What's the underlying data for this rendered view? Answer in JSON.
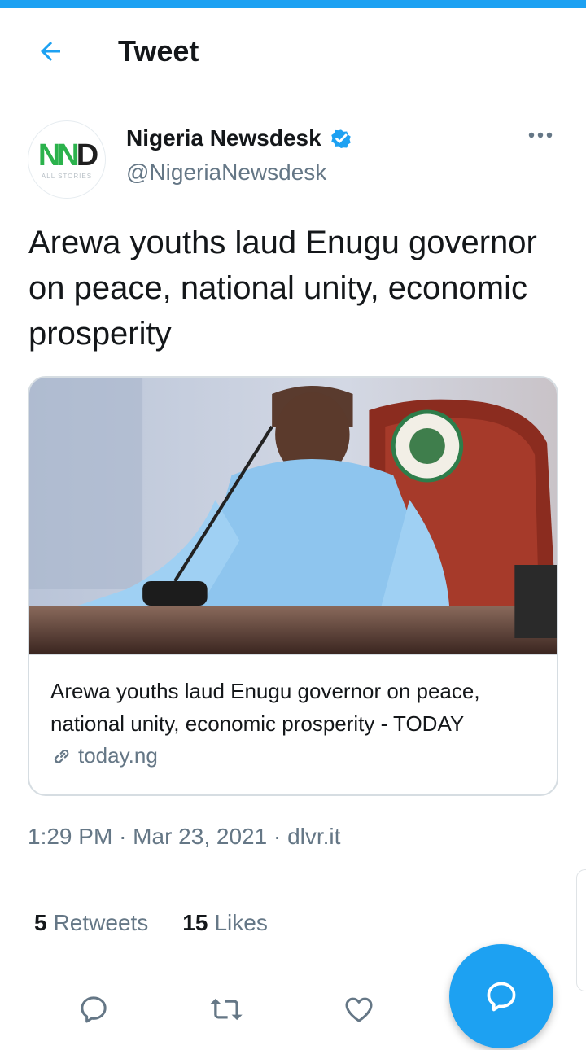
{
  "header": {
    "title": "Tweet",
    "back_icon": "arrow-left-icon"
  },
  "author": {
    "name": "Nigeria Newsdesk",
    "handle": "@NigeriaNewsdesk",
    "verified": true,
    "avatar_logo_text": "NND",
    "avatar_sub_text": "ALL STORIES"
  },
  "tweet": {
    "text": "Arewa youths laud Enugu governor on peace, national unity, economic prosperity"
  },
  "card": {
    "title": "Arewa youths laud Enugu governor on peace, national unity, economic prosperity - TODAY",
    "domain": "today.ng",
    "image_description": "photo"
  },
  "meta": {
    "time": "1:29 PM",
    "separator": "·",
    "date": "Mar 23, 2021",
    "source": "dlvr.it"
  },
  "stats": {
    "retweets_count": "5",
    "retweets_label": "Retweets",
    "likes_count": "15",
    "likes_label": "Likes"
  },
  "actions": {
    "reply_icon": "reply-icon",
    "retweet_icon": "retweet-icon",
    "like_icon": "heart-icon",
    "compose_icon": "compose-reply-icon"
  },
  "colors": {
    "accent": "#1da1f2",
    "text": "#14171a",
    "secondary": "#657786",
    "border": "#dfe3e6"
  }
}
